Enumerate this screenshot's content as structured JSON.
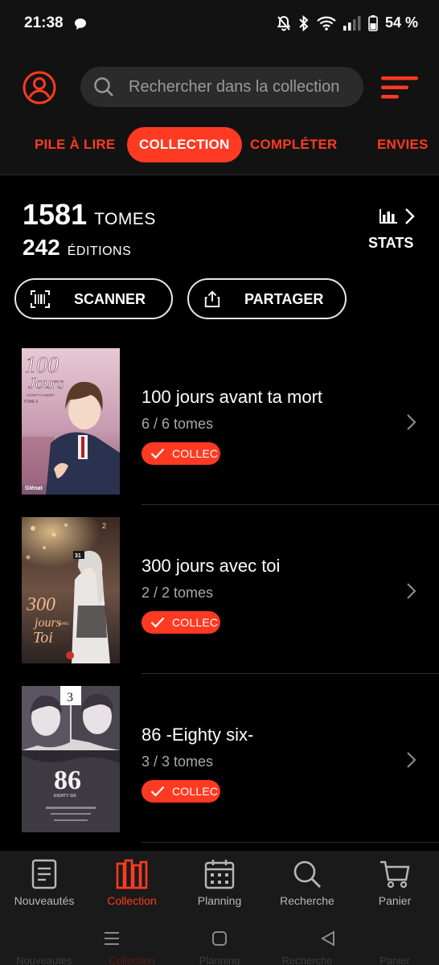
{
  "status_bar": {
    "time": "21:38",
    "battery": "54 %"
  },
  "header": {
    "search_placeholder": "Rechercher dans la collection"
  },
  "tabs": [
    {
      "label": "PILE À LIRE"
    },
    {
      "label": "COLLECTION",
      "active": true
    },
    {
      "label": "COMPLÉTER"
    },
    {
      "label": "ENVIES"
    }
  ],
  "stats": {
    "tomes_count": "1581",
    "tomes_unit": "TOMES",
    "editions_count": "242",
    "editions_unit": "ÉDITIONS",
    "stats_label": "STATS"
  },
  "actions": {
    "scan_label": "SCANNER",
    "share_label": "PARTAGER"
  },
  "items": [
    {
      "title": "100 jours avant ta mort",
      "subtitle": "6 / 6 tomes",
      "badge": "COLLEC",
      "cover_title": "100",
      "cover_title2": "Jours",
      "cover_sub": "AVANT TA MORT",
      "cover_tome": "TOME 6",
      "cover_publisher": "Glénat"
    },
    {
      "title": "300 jours avec toi",
      "subtitle": "2 / 2 tomes",
      "badge": "COLLEC",
      "cover_title": "300",
      "cover_title2": "jours",
      "cover_sub": "avec",
      "cover_title3": "Toi",
      "cover_tome": "2",
      "cover_badge": "31"
    },
    {
      "title": "86 -Eighty six-",
      "subtitle": "3 / 3 tomes",
      "badge": "COLLEC",
      "cover_title": "86",
      "cover_sub": "EIGHTY SIX",
      "cover_tome": "3"
    }
  ],
  "bottom_nav": [
    {
      "label": "Nouveautés",
      "icon": "news-icon"
    },
    {
      "label": "Collection",
      "icon": "books-icon",
      "active": true
    },
    {
      "label": "Planning",
      "icon": "calendar-icon"
    },
    {
      "label": "Recherche",
      "icon": "search-icon"
    },
    {
      "label": "Panier",
      "icon": "cart-icon"
    }
  ],
  "colors": {
    "accent": "#ff3a22",
    "background": "#000000",
    "surface": "#121212"
  }
}
